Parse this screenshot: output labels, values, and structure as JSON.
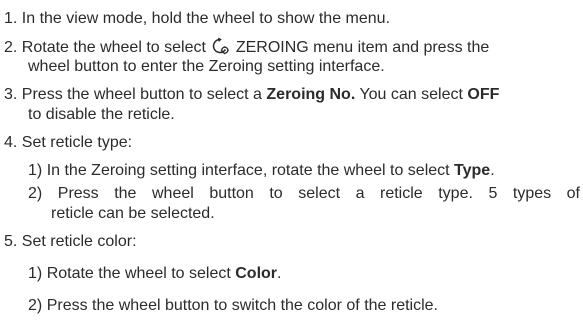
{
  "steps": [
    {
      "num": "1.",
      "text": "In the view mode, hold the wheel to show the menu."
    },
    {
      "num": "2.",
      "text_before_icon": "Rotate the wheel to select",
      "icon": "zeroing-icon",
      "menu_item": "ZEROING",
      "text_after_menu": "menu item and press the",
      "cont": "wheel button to enter the Zeroing setting interface."
    },
    {
      "num": "3.",
      "text_a": "Press the wheel button to select a",
      "bold_a": "Zeroing No.",
      "text_b": "You can select",
      "bold_b": "OFF",
      "cont": "to disable the reticle."
    },
    {
      "num": "4.",
      "text": "Set reticle type:",
      "sub": [
        {
          "num": "1)",
          "text": "In the Zeroing setting interface, rotate the wheel to select",
          "bold": "Type",
          "end": "."
        },
        {
          "num": "2)",
          "text": "Press the wheel button to select a reticle type. 5 types of",
          "cont": "reticle can be selected."
        }
      ]
    },
    {
      "num": "5.",
      "text": "Set reticle color:",
      "sub": [
        {
          "num": "1)",
          "text": "Rotate the wheel to select",
          "bold": "Color",
          "end": "."
        },
        {
          "num": "2)",
          "text": "Press the wheel button to switch the color of the reticle."
        }
      ]
    }
  ]
}
